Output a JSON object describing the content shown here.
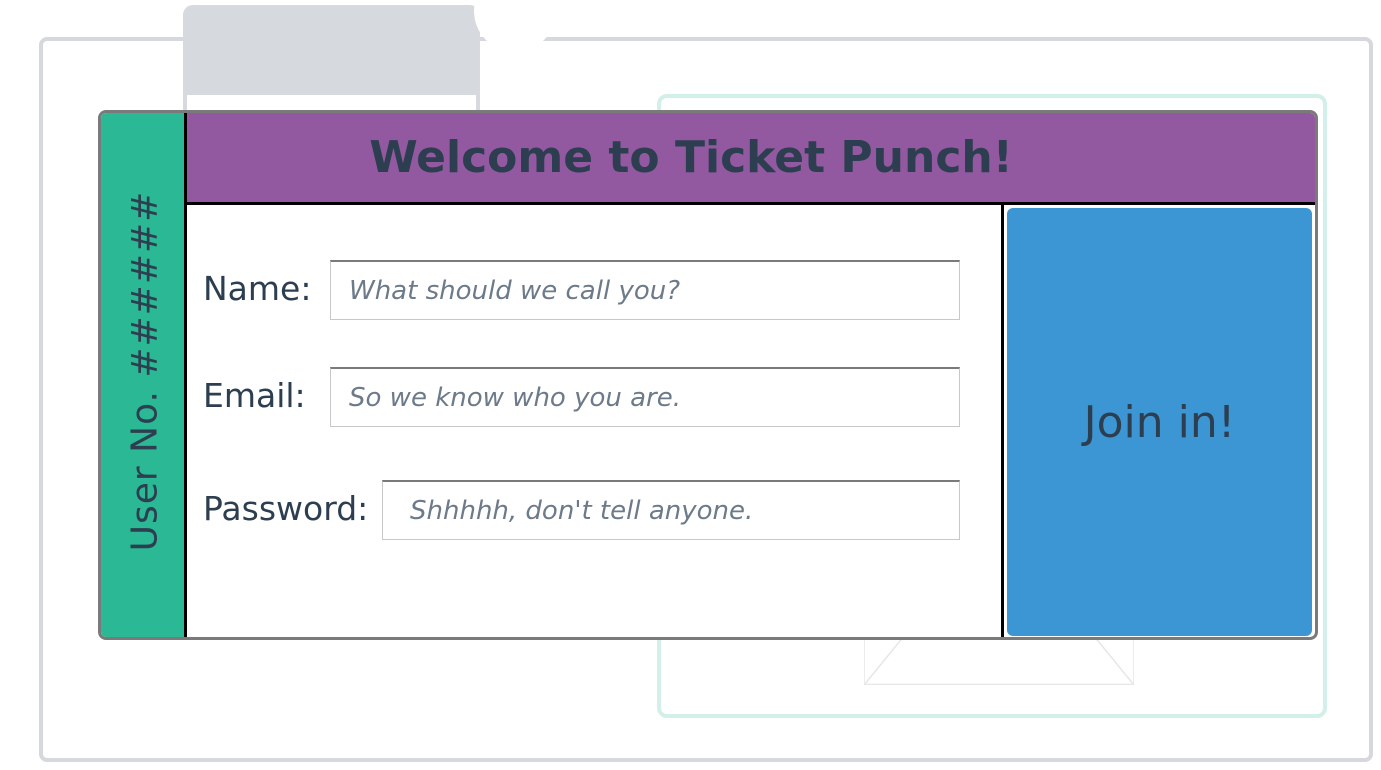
{
  "ticket": {
    "title": "Welcome to Ticket Punch!",
    "stub_label": "User No. ######"
  },
  "form": {
    "name": {
      "label": "Name:",
      "placeholder": "What should we call you?",
      "value": ""
    },
    "email": {
      "label": "Email:",
      "placeholder": "So we know who you are.",
      "value": ""
    },
    "password": {
      "label": "Password:",
      "placeholder": "Shhhhh, don't tell anyone.",
      "value": ""
    }
  },
  "join_button": {
    "label": "Join in!"
  },
  "colors": {
    "stub": "#2bb894",
    "header": "#9359a0",
    "button": "#3d96d4",
    "text": "#2c3e50",
    "ghost_tab": "#d6d9dd",
    "ghost_card_border": "#d3efe9"
  }
}
